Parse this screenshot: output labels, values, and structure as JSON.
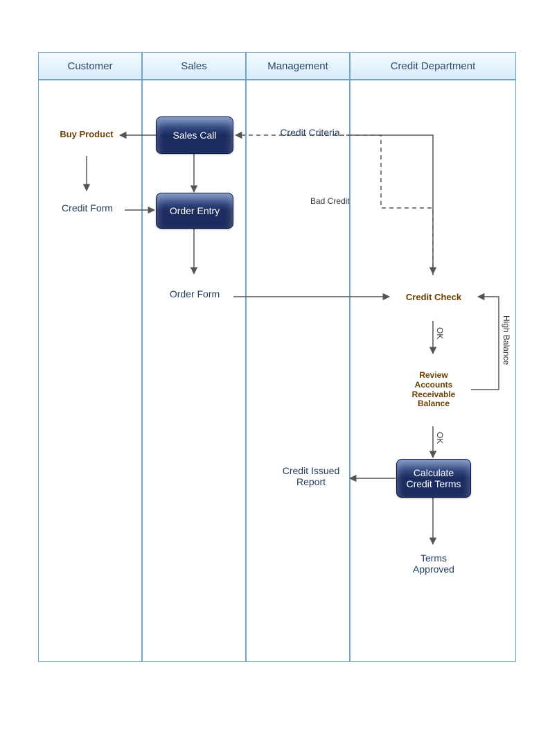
{
  "lanes": {
    "customer": "Customer",
    "sales": "Sales",
    "management": "Management",
    "creditDept": "Credit Department"
  },
  "nodes": {
    "buyProduct": "Buy Product",
    "salesCall": "Sales Call",
    "creditCriteria": "Credit Criteria",
    "creditForm": "Credit Form",
    "orderEntry": "Order Entry",
    "orderForm": "Order Form",
    "creditCheck": "Credit Check",
    "reviewAR": "Review Accounts Receivable Balance",
    "calcTerms": "Calculate Credit Terms",
    "creditIssued": "Credit Issued Report",
    "termsApproved": "Terms Approved"
  },
  "edgeLabels": {
    "badCredit": "Bad Credit",
    "ok1": "OK",
    "ok2": "OK",
    "highBalance": "High Balance"
  }
}
